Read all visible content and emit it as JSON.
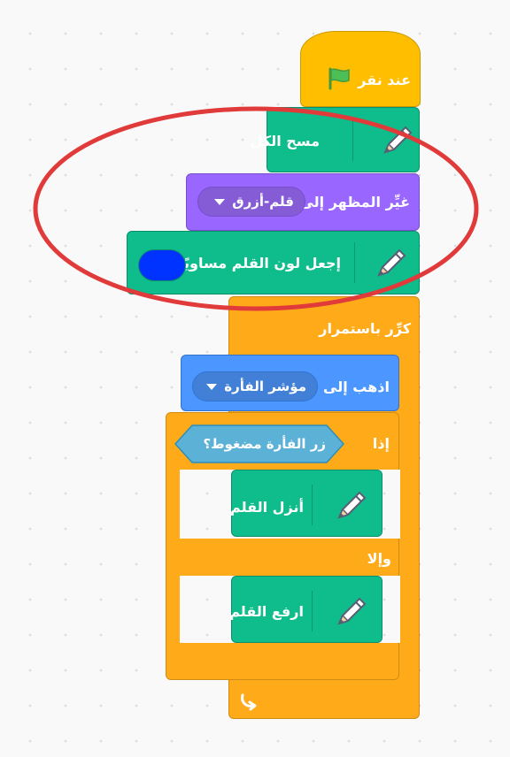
{
  "blocks": {
    "when_flag": "عند نقر",
    "clear_all": "مسح الكل",
    "switch_costume": "غيِّر المظهر إلى",
    "costume_value": "قلم-أزرق",
    "set_pen_color": "إجعل لون القلم مساويًا",
    "pen_color_swatch": "#0033ff",
    "forever": "كرِّر باستمرار",
    "go_to": "اذهب إلى",
    "go_to_value": "مؤشر الفأرة",
    "if_label": "إذا",
    "condition": "زر الفأرة مضغوط؟",
    "pen_down": "أنزل القلم",
    "else_label": "وإلا",
    "pen_up": "ارفع القلم"
  },
  "colors": {
    "event": "#ffbf00",
    "pen": "#0fbd8c",
    "looks": "#9966ff",
    "motion": "#4c97ff",
    "control": "#ffab19",
    "sensing": "#5cb1d6",
    "highlight_ellipse": "#e03a3a"
  },
  "icons": {
    "flag": "green-flag-icon",
    "pen": "pen-extension-icon",
    "dropdown": "dropdown-arrow-icon",
    "loop_arrow": "loop-arrow-icon"
  }
}
